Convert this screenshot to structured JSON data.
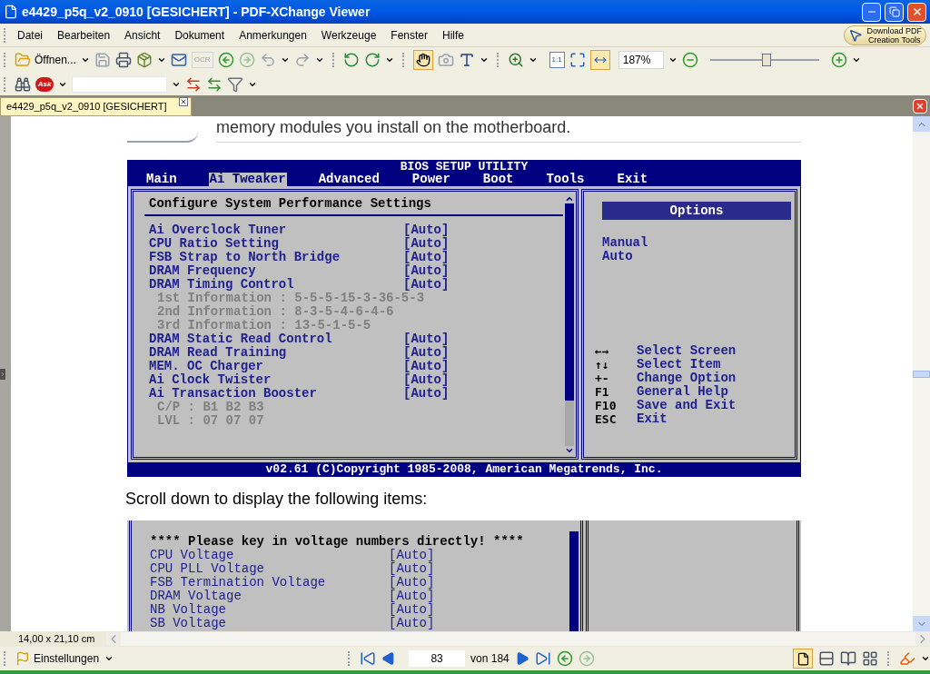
{
  "window": {
    "title": "e4429_p5q_v2_0910 [GESICHERT] - PDF-XChange Viewer"
  },
  "menu": [
    "Datei",
    "Bearbeiten",
    "Ansicht",
    "Dokument",
    "Anmerkungen",
    "Werkzeuge",
    "Fenster",
    "Hilfe"
  ],
  "promo": [
    "Download PDF",
    "Creation Tools"
  ],
  "toolbar": {
    "open_label": "Öffnen...",
    "ocr_label": "OCR",
    "actual_size_label": "1:1",
    "zoom": "187%",
    "zoom_slider": {
      "level": 0.52
    }
  },
  "toolbar2": {
    "ask_label": "Ask"
  },
  "tabs": [
    {
      "label": "e4429_p5q_v2_0910 [GESICHERT]",
      "selected": true
    }
  ],
  "document": {
    "top_text": "memory modules you install on the motherboard.",
    "bios": {
      "title": "BIOS SETUP UTILITY",
      "tabs": [
        {
          "label": "Main",
          "selected": false
        },
        {
          "label": "Ai Tweaker",
          "selected": true
        },
        {
          "label": "Advanced",
          "selected": false
        },
        {
          "label": "Power",
          "selected": false
        },
        {
          "label": "Boot",
          "selected": false
        },
        {
          "label": "Tools",
          "selected": false
        },
        {
          "label": "Exit",
          "selected": false
        }
      ],
      "heading": "Configure System Performance Settings",
      "items": [
        {
          "kind": "setting",
          "label": "Ai Overclock Tuner",
          "value": "[Auto]"
        },
        {
          "kind": "setting",
          "label": "CPU Ratio Setting",
          "value": "[Auto]"
        },
        {
          "kind": "setting",
          "label": "FSB Strap to North Bridge",
          "value": "[Auto]"
        },
        {
          "kind": "setting",
          "label": "DRAM Frequency",
          "value": "[Auto]"
        },
        {
          "kind": "setting",
          "label": "DRAM Timing Control",
          "value": "[Auto]"
        },
        {
          "kind": "info",
          "label": "1st Information : 5-5-5-15-3-36-5-3"
        },
        {
          "kind": "info",
          "label": "2nd Information : 8-3-5-4-6-4-6"
        },
        {
          "kind": "info",
          "label": "3rd Information : 13-5-1-5-5"
        },
        {
          "kind": "setting",
          "label": "DRAM Static Read Control",
          "value": "[Auto]"
        },
        {
          "kind": "setting",
          "label": "DRAM Read Training",
          "value": "[Auto]"
        },
        {
          "kind": "setting",
          "label": "MEM. OC Charger",
          "value": "[Auto]"
        },
        {
          "kind": "setting",
          "label": "Ai Clock Twister",
          "value": "[Auto]"
        },
        {
          "kind": "setting",
          "label": "Ai Transaction Booster",
          "value": "[Auto]"
        },
        {
          "kind": "info",
          "label": "C/P : B1 B2 B3"
        },
        {
          "kind": "info",
          "label": "LVL : 07 07 07"
        }
      ],
      "options_title": "Options",
      "options": [
        "Manual",
        "Auto"
      ],
      "help": [
        {
          "key": "←→",
          "action": "Select Screen"
        },
        {
          "key": "↑↓",
          "action": "Select Item"
        },
        {
          "key": "+-",
          "action": "Change Option"
        },
        {
          "key": "F1",
          "action": "General Help"
        },
        {
          "key": "F10",
          "action": "Save and Exit"
        },
        {
          "key": "ESC",
          "action": "Exit"
        }
      ],
      "footer": "v02.61 (C)Copyright 1985-2008, American Megatrends, Inc."
    },
    "caption": "Scroll down to display the following items:",
    "bios2": {
      "heading": "**** Please key in voltage numbers directly! ****",
      "items": [
        {
          "label": "CPU Voltage",
          "value": "[Auto]"
        },
        {
          "label": "CPU PLL Voltage",
          "value": "[Auto]"
        },
        {
          "label": "FSB Termination Voltage",
          "value": "[Auto]"
        },
        {
          "label": "DRAM Voltage",
          "value": "[Auto]"
        },
        {
          "label": "NB Voltage",
          "value": "[Auto]"
        },
        {
          "label": "SB Voltage",
          "value": "[Auto]"
        }
      ]
    }
  },
  "status_bar": {
    "page_size": "14,00 x 21,10 cm",
    "settings": "Einstellungen",
    "page": "83",
    "page_of": "von 184"
  }
}
